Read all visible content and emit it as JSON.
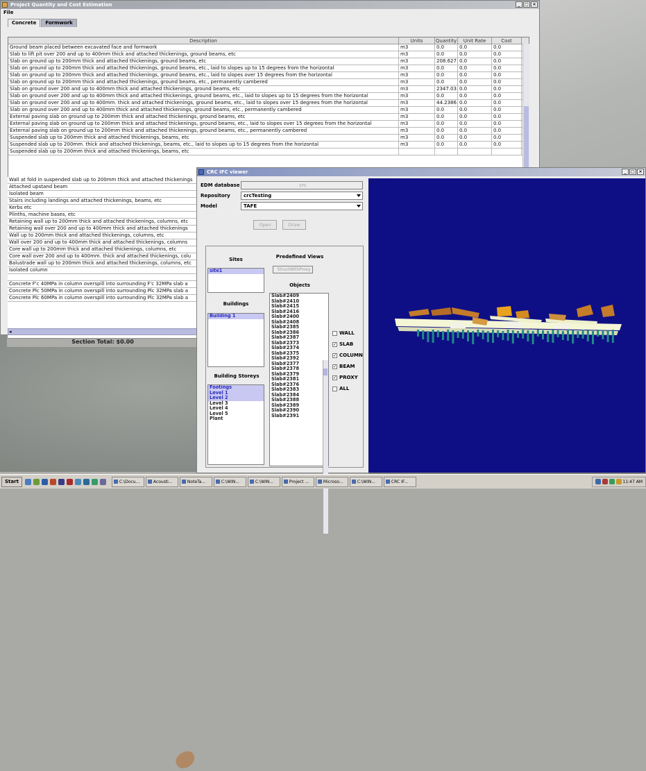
{
  "main_window": {
    "title": "Project Quantity and Cost Estimation",
    "menu_file": "File",
    "tabs": [
      "Concrete",
      "Formwork"
    ],
    "columns": [
      "Description",
      "Units",
      "Quantity",
      "Unit Rate",
      "Cost"
    ],
    "rows": [
      [
        "Ground beam placed between excavated face and formwork",
        "m3",
        "0.0",
        "0.0",
        "0.0"
      ],
      [
        "Slab to lift pit over 200 and up to 400mm thick and attached thickenings, ground beams, etc",
        "m3",
        "0.0",
        "0.0",
        "0.0"
      ],
      [
        "Slab on ground up to 200mm thick and attached thickenings, ground beams, etc",
        "m3",
        "208.627...",
        "0.0",
        "0.0"
      ],
      [
        "Slab on ground up to 200mm thick and attached thickenings, ground beams, etc., laid to slopes up to 15 degrees from the horizontal",
        "m3",
        "0.0",
        "0.0",
        "0.0"
      ],
      [
        "Slab on ground up to 200mm thick and attached thickenings, ground beams, etc., laid to slopes over 15 degrees from the horizontal",
        "m3",
        "0.0",
        "0.0",
        "0.0"
      ],
      [
        "Slab on ground up to 200mm thick and attached thickenings, ground beams, etc., permanently cambered",
        "m3",
        "0.0",
        "0.0",
        "0.0"
      ],
      [
        "Slab on ground over 200 and up to 400mm thick and attached thickenings, ground beams, etc",
        "m3",
        "2347.03...",
        "0.0",
        "0.0"
      ],
      [
        "Slab on ground over 200 and up to 400mm thick and attached thickenings, ground beams, etc., laid to slopes up to 15 degrees from the horizontal",
        "m3",
        "0.0",
        "0.0",
        "0.0"
      ],
      [
        "Slab on ground over 200 and up to 400mm. thick and attached thickenings, ground beams, etc., laid to slopes over 15 degrees from the horizontal",
        "m3",
        "44.2386...",
        "0.0",
        "0.0"
      ],
      [
        "Slab on ground over 200 and up to 400mm thick and attached thickenings, ground beams, etc., permanently cambered",
        "m3",
        "0.0",
        "0.0",
        "0.0"
      ],
      [
        "External paving slab on ground up to 200mm thick and attached thickenings, ground beams, etc",
        "m3",
        "0.0",
        "0.0",
        "0.0"
      ],
      [
        "External paving slab on ground up to 200mm thick and attached thickenings, ground beams, etc., laid to slopes over 15 degrees from the horizontal",
        "m3",
        "0.0",
        "0.0",
        "0.0"
      ],
      [
        "External paving slab on ground up to 200mm thick and attached thickenings, ground beams, etc., permanently cambered",
        "m3",
        "0.0",
        "0.0",
        "0.0"
      ],
      [
        "Suspended slab up to 200mm thick and attached thickenings, beams, etc",
        "m3",
        "0.0",
        "0.0",
        "0.0"
      ],
      [
        "Suspended slab up to 200mm. thick and attached thickenings, beams, etc., laid to slopes up to 15 degrees from the horizontal",
        "m3",
        "0.0",
        "0.0",
        "0.0"
      ],
      [
        "Suspended slab up to 200mm thick and attached thickenings, beams, etc",
        "",
        "",
        "",
        ""
      ]
    ],
    "lower_rows": [
      "Wall at fold in suspended slab up to 200mm thick and attached thickenings",
      "Attached upstand beam",
      "Isolated beam",
      "Stairs including landings and attached thickenings, beams, etc",
      "Kerbs etc",
      "Plinths, machine bases, etc",
      "Retaining wall up to 200mm thick and attached thickenings, columns, etc",
      "Retaining wall over 200 and up to 400mm thick and attached thickenings",
      "Wall up to 200mm thick and attached thickenings, columns, etc",
      "Wall over 200 and up to 400mm thick and attached thickenings, columns",
      "Core wall up to 200mm thick and attached thickenings, columns, etc",
      "Core wall over 200 and up to 400mm. thick and attached thickenings, colu",
      "Balustrade wall up to 200mm thick and attached thickenings, columns, etc",
      "Isolated column",
      "",
      "Concrete F'c 40MPa in column overspill into surrounding F'c 32MPa slab a",
      "Concrete Plc 50MPa in column overspill into surrounding Plc 32MPa slab a",
      "Concrete Plc 60MPa in column overspill into surrounding Plc 32MPa slab a"
    ],
    "section_total": "Section Total: $0.00"
  },
  "viewer_window": {
    "title": "CRC IFC viewer",
    "edm_label": "EDM database",
    "edm_value": "crc",
    "repository_label": "Repository",
    "repository_value": "crcTesting",
    "model_label": "Model",
    "model_value": "TAFE",
    "open_button": "Open",
    "draw_button": "Draw",
    "sites_title": "Sites",
    "sites": [
      "site1"
    ],
    "predefined_views_title": "Predefined Views",
    "predefined_views_value": "StructWithProxy",
    "buildings_title": "Buildings",
    "buildings": [
      "Building 1"
    ],
    "objects_title": "Objects",
    "objects": [
      "Slab#2409",
      "Slab#2410",
      "Slab#2415",
      "Slab#2416",
      "Slab#2400",
      "Slab#2408",
      "Slab#2385",
      "Slab#2386",
      "Slab#2387",
      "Slab#2373",
      "Slab#2374",
      "Slab#2375",
      "Slab#2392",
      "Slab#2377",
      "Slab#2378",
      "Slab#2379",
      "Slab#2381",
      "Slab#2376",
      "Slab#2383",
      "Slab#2384",
      "Slab#2388",
      "Slab#2389",
      "Slab#2390",
      "Slab#2391"
    ],
    "storeys_title": "Building Storeys",
    "storeys": [
      {
        "label": "Footings",
        "selected": true
      },
      {
        "label": "Level 1",
        "selected": true
      },
      {
        "label": "Level 2",
        "selected": true
      },
      {
        "label": "Level 3",
        "selected": false
      },
      {
        "label": "Level 4",
        "selected": false
      },
      {
        "label": "Level 5",
        "selected": false
      },
      {
        "label": "Plant",
        "selected": false
      }
    ],
    "filters": [
      {
        "label": "WALL",
        "checked": false
      },
      {
        "label": "SLAB",
        "checked": true
      },
      {
        "label": "COLUMN",
        "checked": true
      },
      {
        "label": "BEAM",
        "checked": true
      },
      {
        "label": "PROXY",
        "checked": true
      },
      {
        "label": "ALL",
        "checked": false
      }
    ]
  },
  "taskbar": {
    "start": "Start",
    "tasks": [
      "C:\\Docu...",
      "Acousti...",
      "NoteTa...",
      "C:\\WIN...",
      "C:\\WIN...",
      "Project ...",
      "Microso...",
      "C:\\WIN...",
      "CRC IF..."
    ],
    "clock": "11:47 AM"
  },
  "colors": {
    "canvas_bg": "#0f0f85",
    "selection": "#c8c8f2",
    "tab_inactive": "#b1b5c4"
  }
}
